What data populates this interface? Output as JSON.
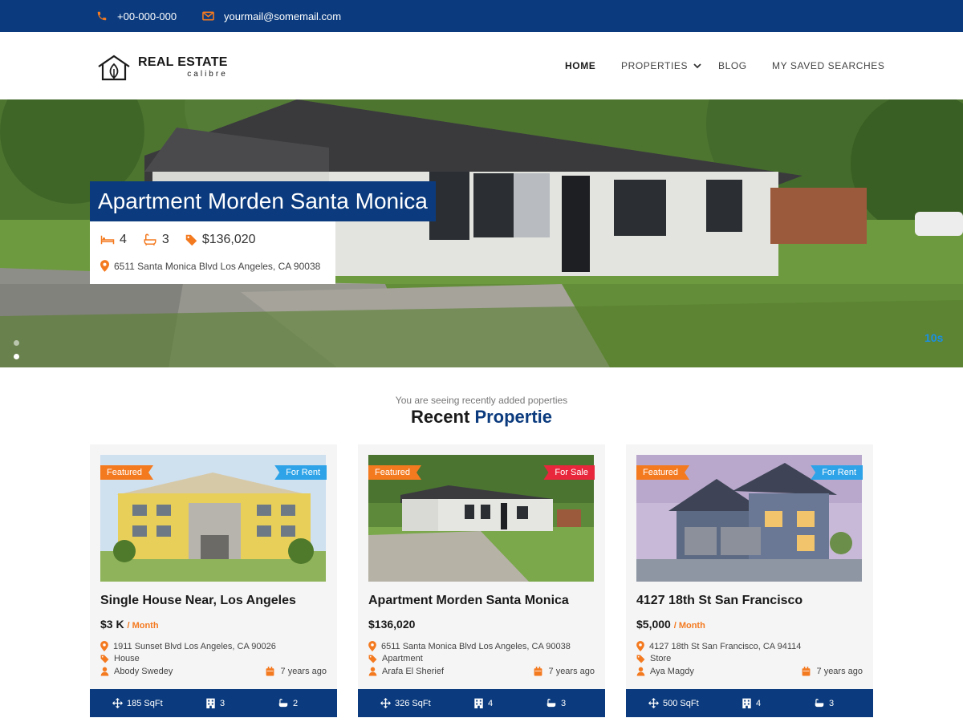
{
  "topbar": {
    "phone": "+00-000-000",
    "email": "yourmail@somemail.com"
  },
  "brand": {
    "title": "REAL ESTATE",
    "subtitle": "calibre"
  },
  "nav": {
    "items": [
      {
        "label": "HOME"
      },
      {
        "label": "PROPERTIES"
      },
      {
        "label": "BLOG"
      },
      {
        "label": "MY SAVED SEARCHES"
      }
    ]
  },
  "hero": {
    "title": "Apartment Morden Santa Monica",
    "beds": "4",
    "baths": "3",
    "price": "$136,020",
    "address": "6511 Santa Monica Blvd Los Angeles, CA 90038",
    "timer": "10s"
  },
  "section": {
    "subtitle": "You are seeing recently added poperties",
    "title_part1": "Recent",
    "title_part2": "Propertie"
  },
  "colors": {
    "primary": "#0b3b7e",
    "accent": "#f47a20",
    "for_rent": "#2ea3e8",
    "for_sale": "#e8273c"
  },
  "cards": [
    {
      "featured": "Featured",
      "status": "For Rent",
      "title": "Single House Near, Los Angeles",
      "price": "$3 K",
      "period": "/ Month",
      "address": "1911 Sunset Blvd Los Angeles, CA 90026",
      "type": "House",
      "agent": "Abody Swedey",
      "date": "7 years ago",
      "area": "185 SqFt",
      "beds": "3",
      "baths": "2"
    },
    {
      "featured": "Featured",
      "status": "For Sale",
      "title": "Apartment Morden Santa Monica",
      "price": "$136,020",
      "period": "",
      "address": "6511 Santa Monica Blvd Los Angeles, CA 90038",
      "type": "Apartment",
      "agent": "Arafa El Sherief",
      "date": "7 years ago",
      "area": "326 SqFt",
      "beds": "4",
      "baths": "3"
    },
    {
      "featured": "Featured",
      "status": "For Rent",
      "title": "4127 18th St San Francisco",
      "price": "$5,000",
      "period": "/ Month",
      "address": "4127 18th St San Francisco, CA 94114",
      "type": "Store",
      "agent": "Aya Magdy",
      "date": "7 years ago",
      "area": "500 SqFt",
      "beds": "4",
      "baths": "3"
    }
  ]
}
